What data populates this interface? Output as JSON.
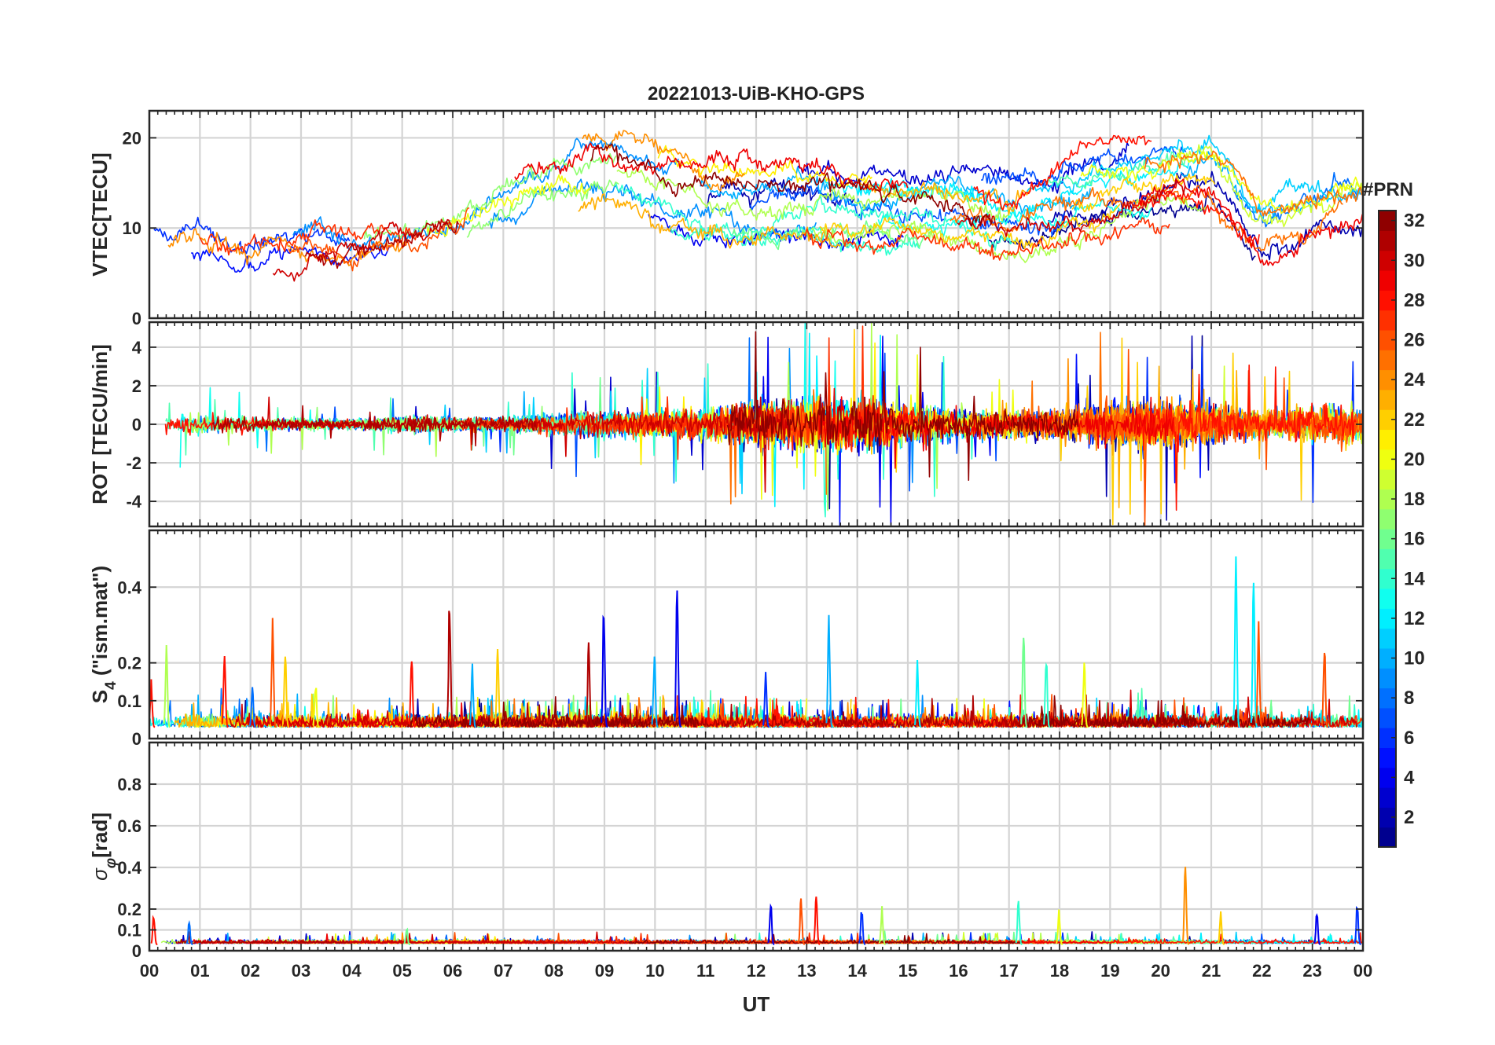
{
  "chart_data": {
    "type": "line",
    "title": "20221013-UiB-KHO-GPS",
    "xlabel": "UT",
    "x_tick_labels": [
      "00",
      "01",
      "02",
      "03",
      "04",
      "05",
      "06",
      "07",
      "08",
      "09",
      "10",
      "11",
      "12",
      "13",
      "14",
      "15",
      "16",
      "17",
      "18",
      "19",
      "20",
      "21",
      "22",
      "23",
      "00"
    ],
    "xlim": [
      0,
      24
    ],
    "grid": true,
    "panels": [
      {
        "ylabel": "VTEC[TECU]",
        "ylim": [
          0,
          23
        ],
        "yticks": [
          0,
          10,
          20
        ],
        "ytick_labels": [
          "0",
          "10",
          "20"
        ],
        "kind": "tec",
        "baseline": [
          [
            0,
            8
          ],
          [
            1,
            7.5
          ],
          [
            2,
            6
          ],
          [
            3,
            6.5
          ],
          [
            4,
            7
          ],
          [
            5,
            8
          ],
          [
            6,
            9.5
          ],
          [
            7,
            12
          ],
          [
            8,
            15
          ],
          [
            9,
            16
          ],
          [
            10,
            14
          ],
          [
            11,
            12
          ],
          [
            12,
            12
          ],
          [
            13,
            13
          ],
          [
            14,
            12
          ],
          [
            15,
            12
          ],
          [
            16,
            12
          ],
          [
            17,
            11
          ],
          [
            18,
            12
          ],
          [
            19,
            14
          ],
          [
            20,
            15
          ],
          [
            21,
            16
          ],
          [
            22,
            9
          ],
          [
            23,
            11
          ],
          [
            24,
            12
          ]
        ]
      },
      {
        "ylabel": "ROT [TECU/min]",
        "ylim": [
          -5.3,
          5.3
        ],
        "yticks": [
          -4,
          -2,
          0,
          2,
          4
        ],
        "ytick_labels": [
          "-4",
          "-2",
          "0",
          "2",
          "4"
        ],
        "kind": "rot",
        "activity": [
          [
            0,
            0.6
          ],
          [
            1,
            0.6
          ],
          [
            2,
            0.4
          ],
          [
            3,
            0.35
          ],
          [
            4,
            0.3
          ],
          [
            5,
            0.5
          ],
          [
            6,
            0.4
          ],
          [
            7,
            0.4
          ],
          [
            8,
            0.6
          ],
          [
            9,
            0.8
          ],
          [
            10,
            0.8
          ],
          [
            11,
            0.9
          ],
          [
            12,
            1.4
          ],
          [
            13,
            1.6
          ],
          [
            14,
            1.6
          ],
          [
            15,
            1.2
          ],
          [
            16,
            0.9
          ],
          [
            17,
            0.8
          ],
          [
            18,
            0.9
          ],
          [
            19,
            1.3
          ],
          [
            20,
            1.4
          ],
          [
            21,
            1.3
          ],
          [
            22,
            0.8
          ],
          [
            23,
            1.1
          ],
          [
            24,
            1.2
          ]
        ]
      },
      {
        "ylabel": "S4 (\"ism.mat\")",
        "ylabel_main": "S",
        "ylabel_sub": "4",
        "ylabel_rest": " (\"ism.mat\")",
        "ylim": [
          0,
          0.55
        ],
        "yticks": [
          0,
          0.1,
          0.2,
          0.4
        ],
        "ytick_labels": [
          "0",
          "0.1",
          "0.2",
          "0.4"
        ],
        "kind": "s4",
        "spikes": [
          [
            0.35,
            0.27,
            18
          ],
          [
            1.5,
            0.26,
            28
          ],
          [
            2.45,
            0.32,
            26
          ],
          [
            2.7,
            0.27,
            22
          ],
          [
            3.3,
            0.16,
            20
          ],
          [
            5.2,
            0.24,
            28
          ],
          [
            5.95,
            0.41,
            31
          ],
          [
            6.9,
            0.26,
            22
          ],
          [
            8.7,
            0.28,
            31
          ],
          [
            9.0,
            0.39,
            4
          ],
          [
            10.0,
            0.24,
            10
          ],
          [
            10.45,
            0.46,
            4
          ],
          [
            12.2,
            0.18,
            6
          ],
          [
            13.45,
            0.37,
            10
          ],
          [
            15.2,
            0.22,
            12
          ],
          [
            17.3,
            0.3,
            16
          ],
          [
            17.75,
            0.24,
            14
          ],
          [
            18.5,
            0.22,
            20
          ],
          [
            21.5,
            0.54,
            12
          ],
          [
            21.85,
            0.45,
            12
          ],
          [
            21.95,
            0.33,
            26
          ],
          [
            23.25,
            0.27,
            26
          ],
          [
            0.05,
            0.16,
            28
          ],
          [
            2.05,
            0.14,
            8
          ],
          [
            6.4,
            0.2,
            10
          ]
        ]
      },
      {
        "ylabel": "σφ[rad]",
        "ylabel_main": "σ",
        "ylabel_sub": "φ",
        "ylabel_rest": "[rad]",
        "ylim": [
          0,
          1.0
        ],
        "yticks": [
          0,
          0.1,
          0.2,
          0.4,
          0.6,
          0.8
        ],
        "ytick_labels": [
          "0",
          "0.1",
          "0.2",
          "0.4",
          "0.6",
          "0.8"
        ],
        "kind": "sigma",
        "spikes": [
          [
            0.1,
            0.19,
            28
          ],
          [
            0.8,
            0.15,
            8
          ],
          [
            5.1,
            0.12,
            16
          ],
          [
            12.3,
            0.25,
            4
          ],
          [
            12.9,
            0.28,
            26
          ],
          [
            13.2,
            0.29,
            28
          ],
          [
            14.1,
            0.22,
            6
          ],
          [
            14.5,
            0.22,
            18
          ],
          [
            17.2,
            0.27,
            14
          ],
          [
            18.0,
            0.2,
            20
          ],
          [
            20.5,
            0.46,
            24
          ],
          [
            21.2,
            0.2,
            22
          ],
          [
            23.1,
            0.2,
            4
          ],
          [
            23.9,
            0.25,
            6
          ]
        ]
      }
    ],
    "colorbar": {
      "label": "#PRN",
      "min": 1,
      "max": 32,
      "tick_labels": [
        "2",
        "4",
        "6",
        "8",
        "10",
        "12",
        "14",
        "16",
        "18",
        "20",
        "22",
        "24",
        "26",
        "28",
        "30",
        "32"
      ]
    }
  }
}
